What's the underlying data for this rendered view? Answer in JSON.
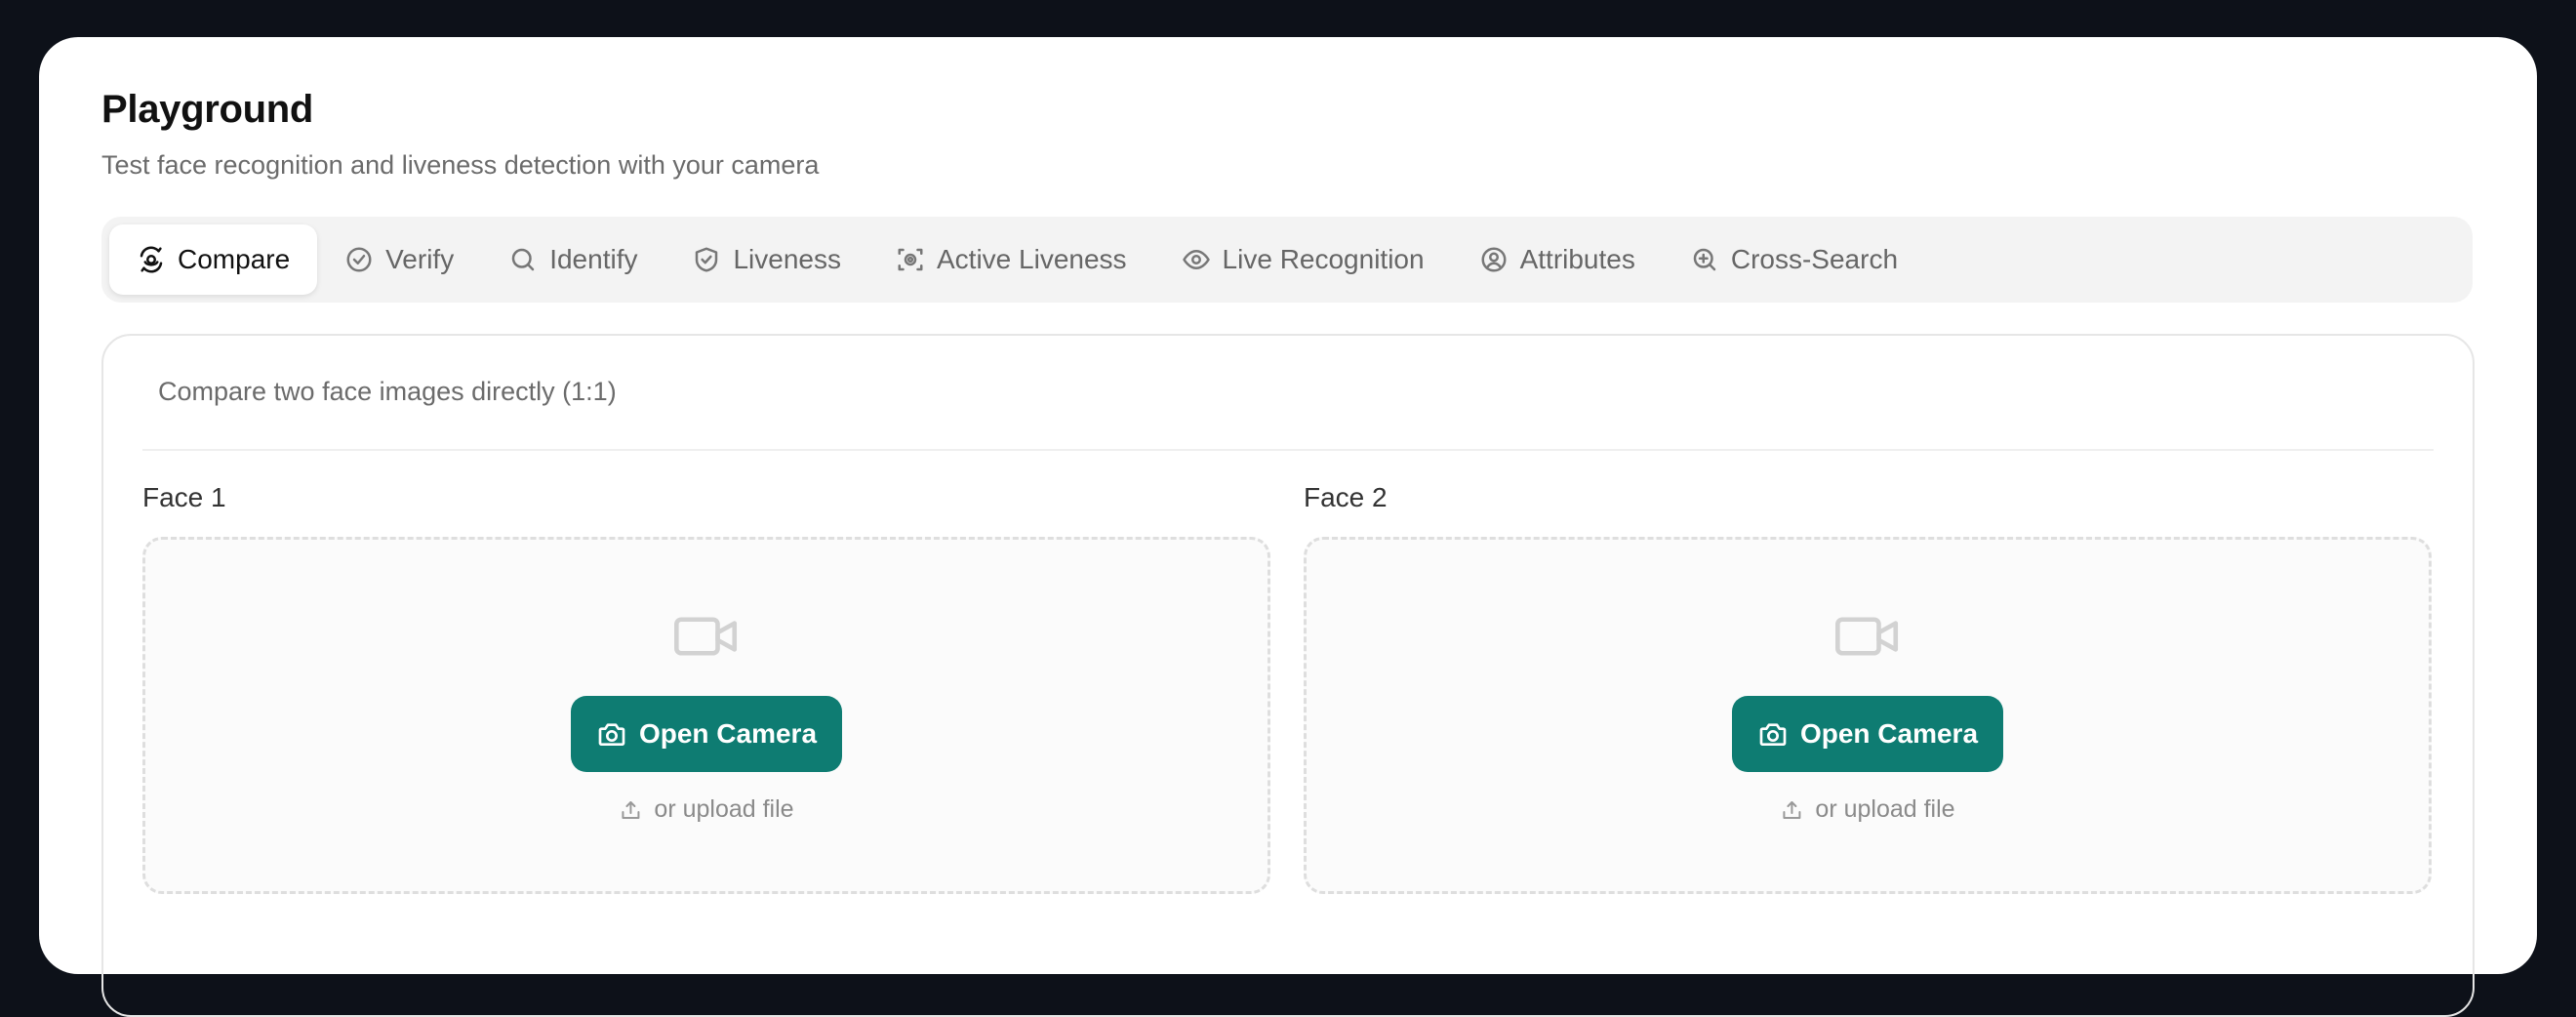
{
  "header": {
    "title": "Playground",
    "subtitle": "Test face recognition and liveness detection with your camera"
  },
  "tabs": [
    {
      "label": "Compare",
      "icon": "face-scan-icon",
      "active": true
    },
    {
      "label": "Verify",
      "icon": "check-circle-icon",
      "active": false
    },
    {
      "label": "Identify",
      "icon": "search-icon",
      "active": false
    },
    {
      "label": "Liveness",
      "icon": "shield-check-icon",
      "active": false
    },
    {
      "label": "Active Liveness",
      "icon": "scan-face-icon",
      "active": false
    },
    {
      "label": "Live Recognition",
      "icon": "eye-icon",
      "active": false
    },
    {
      "label": "Attributes",
      "icon": "user-circle-icon",
      "active": false
    },
    {
      "label": "Cross-Search",
      "icon": "zoom-in-icon",
      "active": false
    }
  ],
  "panel": {
    "description": "Compare two face images directly (1:1)",
    "faces": [
      {
        "label": "Face 1",
        "button_label": "Open Camera",
        "upload_label": "or upload file"
      },
      {
        "label": "Face 2",
        "button_label": "Open Camera",
        "upload_label": "or upload file"
      }
    ]
  },
  "colors": {
    "accent": "#0e7c72",
    "background": "#0d1119",
    "card": "#ffffff"
  }
}
